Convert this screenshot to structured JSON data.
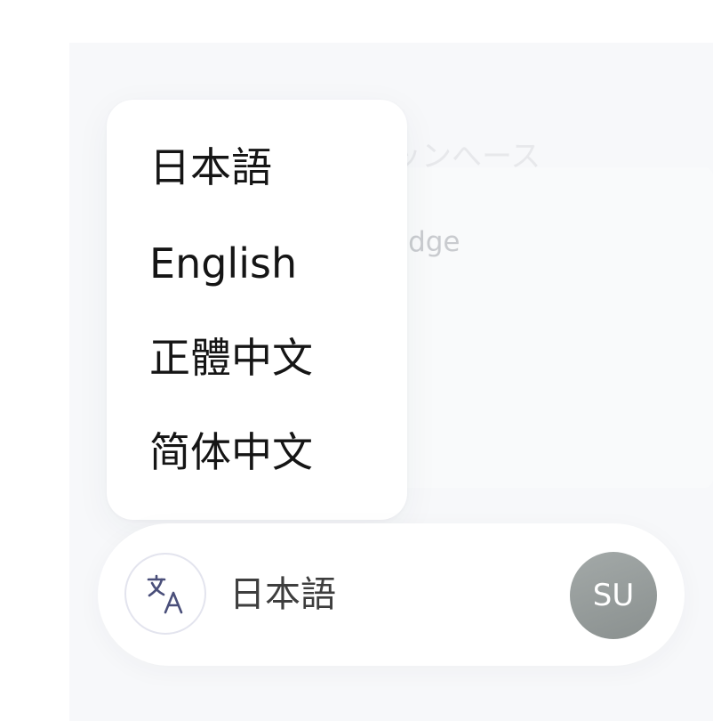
{
  "background": {
    "title_partial": "ッンへース",
    "subtitle_partial": "edge"
  },
  "language_menu": {
    "items": [
      {
        "label": "日本語"
      },
      {
        "label": "English"
      },
      {
        "label": "正體中文"
      },
      {
        "label": "简体中文"
      }
    ]
  },
  "footer": {
    "language_icon": "translate-icon",
    "current_language": "日本語",
    "avatar_initials": "SU",
    "colors": {
      "icon": "#4a4f7a",
      "avatar_bg": "#959b9a"
    }
  }
}
